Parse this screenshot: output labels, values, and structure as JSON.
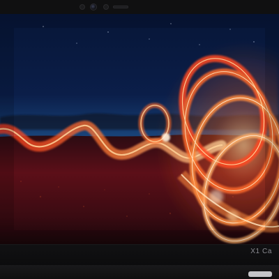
{
  "device": {
    "model_mark": "X1 Ca"
  },
  "icons": {
    "camera": "webcam-icon",
    "sensor": "sensor-icon",
    "shutter": "privacy-shutter-icon"
  },
  "colors": {
    "sky_top": "#0b1e49",
    "sky_horizon": "#2e73a7",
    "ground": "#5c0f18",
    "light_trail": "#ff6a2a",
    "highlight": "#ffd39a"
  }
}
